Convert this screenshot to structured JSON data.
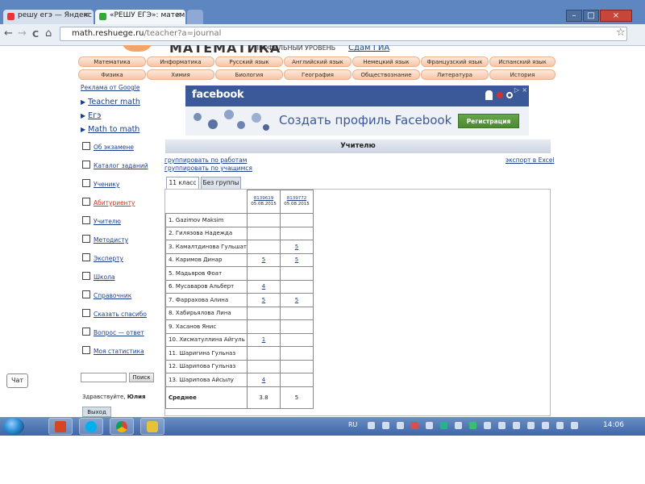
{
  "browser": {
    "tabs": [
      {
        "label": "решу егэ — Яндекс",
        "active": false,
        "close": "×"
      },
      {
        "label": "«РЕШУ ЕГЭ»: матем",
        "active": true,
        "close": "×"
      }
    ],
    "window_controls": [
      "–",
      "□",
      "×"
    ],
    "nav": {
      "back": "←",
      "forward": "→",
      "reload": "C",
      "home": "⌂",
      "star": "☆"
    },
    "address": {
      "host": "math.reshuege.ru",
      "path": "/teacher?a=journal"
    }
  },
  "site": {
    "title": "МАТЕМАТИКА",
    "subtitle": "ПРОФИЛЬНЫЙ УРОВЕНЬ",
    "ege_link": "Сдам ГИА"
  },
  "subjects_row1": [
    "Математика",
    "Информатика",
    "Русский язык",
    "Английский язык",
    "Немецкий язык",
    "Французский язык",
    "Испанский язык"
  ],
  "subjects_row2": [
    "Физика",
    "Химия",
    "Биология",
    "География",
    "Обществознание",
    "Литература",
    "История"
  ],
  "sidebar": {
    "ads_header": "Реклама от Google",
    "ads": [
      "Teacher math",
      "Егэ",
      "Math to math"
    ],
    "menu": [
      {
        "label": "Об экзамене",
        "highlight": false
      },
      {
        "label": "Каталог заданий",
        "highlight": false
      },
      {
        "label": "Ученику",
        "highlight": false
      },
      {
        "label": "Абитуриенту",
        "highlight": true
      },
      {
        "label": "Учителю",
        "highlight": false
      },
      {
        "label": "Методисту",
        "highlight": false
      },
      {
        "label": "Эксперту",
        "highlight": false
      },
      {
        "label": "Школа",
        "highlight": false
      },
      {
        "label": "Справочник",
        "highlight": false
      },
      {
        "label": "Сказать спасибо",
        "highlight": false
      },
      {
        "label": "Вопрос — ответ",
        "highlight": false
      },
      {
        "label": "Моя статистика",
        "highlight": false
      }
    ],
    "search_button": "Поиск",
    "greeting_prefix": "Здравствуйте,",
    "greeting_name": "Юлия",
    "logout": "Выход"
  },
  "chat": "Чат",
  "fb_ad": {
    "logo": "facebook",
    "cta": "Создать профиль Facebook",
    "register": "Регистрация"
  },
  "main": {
    "header": "Учителю",
    "group_by_works": "группировать по работам",
    "group_by_students": "группировать по учащимся",
    "export": "экспорт в Excel",
    "tabs": [
      {
        "label": "11 класс",
        "active": true
      },
      {
        "label": "Без группы",
        "active": false
      }
    ],
    "columns": [
      {
        "work_id": "8139619",
        "date": "05.08.2015"
      },
      {
        "work_id": "8139772",
        "date": "05.08.2015"
      }
    ],
    "rows": [
      {
        "name": "1. Gazimov Maksim",
        "c1": "",
        "c2": ""
      },
      {
        "name": "2. Гилязова Надежда",
        "c1": "",
        "c2": ""
      },
      {
        "name": "3. Камалтдинова Гульшат",
        "c1": "",
        "c2": "5"
      },
      {
        "name": "4. Каримов Динар",
        "c1": "5",
        "c2": "5"
      },
      {
        "name": "5. Мадьяров Фоат",
        "c1": "",
        "c2": ""
      },
      {
        "name": "6. Мусаваров Альберт",
        "c1": "4",
        "c2": ""
      },
      {
        "name": "7. Фаррахова Алина",
        "c1": "5",
        "c2": "5"
      },
      {
        "name": "8. Хабирьялова Лина",
        "c1": "",
        "c2": ""
      },
      {
        "name": "9. Хасанов Янис",
        "c1": "",
        "c2": ""
      },
      {
        "name": "10. Хисматуллина Айгуль",
        "c1": "1",
        "c2": ""
      },
      {
        "name": "11. Шаригина Гульназ",
        "c1": "",
        "c2": ""
      },
      {
        "name": "12. Шарипова Гульназ",
        "c1": "",
        "c2": ""
      },
      {
        "name": "13. Шарипова Айсылу",
        "c1": "4",
        "c2": ""
      }
    ],
    "average": {
      "label": "Среднее",
      "c1": "3.8",
      "c2": "5"
    }
  },
  "taskbar": {
    "lang": "RU",
    "clock": "14:06"
  }
}
